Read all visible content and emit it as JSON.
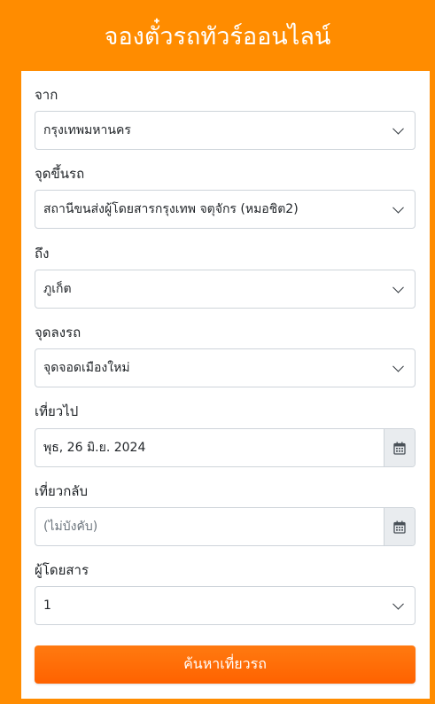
{
  "header": {
    "title": "จองตั๋วรถทัวร์ออนไลน์"
  },
  "form": {
    "from": {
      "label": "จาก",
      "value": "กรุงเทพมหานคร"
    },
    "pickup": {
      "label": "จุดขึ้นรถ",
      "value": "สถานีขนส่งผู้โดยสารกรุงเทพ จตุจักร (หมอชิต2)"
    },
    "to": {
      "label": "ถึง",
      "value": "ภูเก็ต"
    },
    "dropoff": {
      "label": "จุดลงรถ",
      "value": "จุดจอดเมืองใหม่"
    },
    "depart": {
      "label": "เที่ยวไป",
      "value": "พุธ, 26 มิ.ย. 2024",
      "icon": "calendar-icon"
    },
    "return": {
      "label": "เที่ยวกลับ",
      "placeholder": "(ไม่บังคับ)",
      "value": "",
      "icon": "calendar-icon"
    },
    "passengers": {
      "label": "ผู้โดยสาร",
      "value": "1"
    },
    "submit_label": "ค้นหาเที่ยวรถ"
  },
  "colors": {
    "background": "#ff8c00",
    "button": "#ff6a00",
    "card": "#ffffff"
  }
}
